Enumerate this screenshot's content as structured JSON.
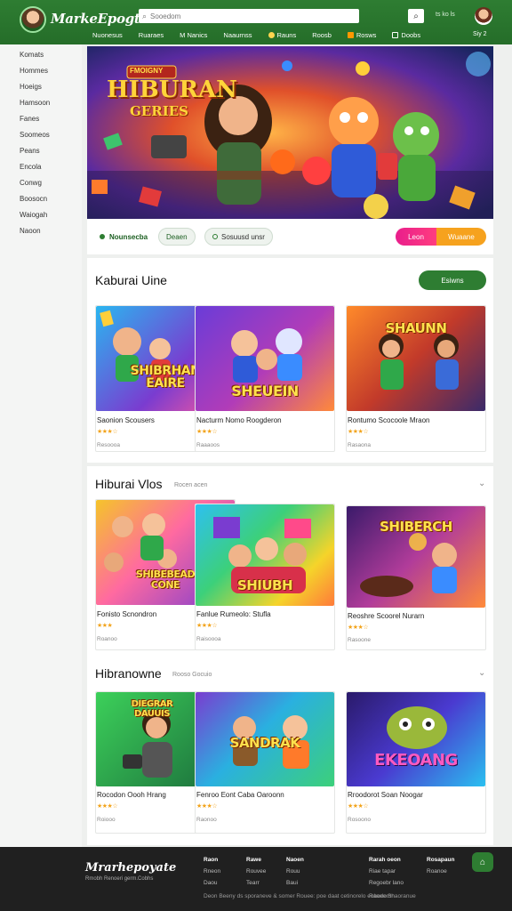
{
  "header": {
    "logo": "MarkeEpogte",
    "search_placeholder": "Sooedom",
    "top_links": "ts ko ls",
    "nav": [
      {
        "label": "Nuonesus",
        "color": "#ffffff"
      },
      {
        "label": "Ruaraes",
        "color": "#ffffff"
      },
      {
        "label": "M Nanics",
        "color": "#ffffff"
      },
      {
        "label": "Naaurnss",
        "color": "#ffffff"
      },
      {
        "label": "Rauns",
        "color": "#ffd54f"
      },
      {
        "label": "Roosb",
        "color": "#ffffff"
      },
      {
        "label": "Rosws",
        "color": "#ff9800"
      },
      {
        "label": "Doobs",
        "color": "#ffffff"
      }
    ],
    "nav_right": "Siy 2"
  },
  "sidebar": {
    "items": [
      "Komats",
      "Hommes",
      "Hoeigs",
      "Hamsoon",
      "Fanes",
      "Soomeos",
      "Peans",
      "Encola",
      "Conwg",
      "Boosocn",
      "Waiogah",
      "Naoon"
    ]
  },
  "hero": {
    "title_top": "HIBURAN",
    "title_bottom": "GERIES",
    "title_badge": "FMOIGNY"
  },
  "filters": {
    "chip1": "Nounsecba",
    "chip2": "Deaen",
    "chip3": "Sosuusd unsr",
    "pill_pink": "Leon",
    "pill_orange": "Wuaane"
  },
  "sections": [
    {
      "title": "Kaburai Uine",
      "subtitle": "",
      "action": "Esiwns",
      "cards": [
        {
          "thumb_title": "SHIBRHAN\nEAIRE",
          "name": "Saonion Scousers",
          "stars": "★★★☆",
          "meta": "Resoooa"
        },
        {
          "thumb_title": "SHEUEIN",
          "name": "Nacturm Nomo Roogderon",
          "stars": "★★★☆",
          "meta": "Raaaoos"
        },
        {
          "thumb_title": "SHAUNN",
          "name": "Rontumo Scocoole Mraon",
          "stars": "★★★☆",
          "meta": "Rasaona"
        }
      ]
    },
    {
      "title": "Hiburai Vlos",
      "subtitle": "Rocen acen",
      "action": "",
      "cards": [
        {
          "thumb_title": "SHIBEBEAD\nCONE",
          "name": "Fonisto Scnondron",
          "stars": "★★★",
          "meta": "Roanoo"
        },
        {
          "thumb_title": "SHIUBH",
          "name": "Fanlue Rumeolo: Stufla",
          "stars": "★★★☆",
          "meta": "Raisoooa"
        },
        {
          "thumb_title": "SHIBERCH",
          "name": "Reoshre Scoorel Nurarn",
          "stars": "★★★☆",
          "meta": "Rasoone"
        }
      ]
    },
    {
      "title": "Hibranowne",
      "subtitle": "Rooso Gocuio",
      "action": "",
      "cards": [
        {
          "thumb_title": "DIEGRAR\nDAUUIS",
          "name": "Rocodon Oooh Hrang",
          "stars": "★★★☆",
          "meta": "Roiooo"
        },
        {
          "thumb_title": "SANDRAK",
          "name": "Fenroo Eont Caba Oaroonn",
          "stars": "★★★☆",
          "meta": "Raonoo"
        },
        {
          "thumb_title": "EKEOANG",
          "name": "Rroodorot Soan Noogar",
          "stars": "★★★☆",
          "meta": "Rosoono"
        }
      ]
    }
  ],
  "footer": {
    "logo": "Mrarhepoyate",
    "tagline": "Rmobh Renoeri germ.Cobhs",
    "cols": [
      {
        "head": "Raon",
        "items": [
          "Rneon",
          "Daou"
        ]
      },
      {
        "head": "Rawe",
        "items": [
          "Rouvee",
          "Tearr"
        ]
      },
      {
        "head": "Naoen",
        "items": [
          "Rouu",
          "Baui"
        ]
      },
      {
        "head": "Rarah oeon",
        "items": [
          "Riae tapar",
          "Regoebr lano"
        ]
      },
      {
        "head": "Rosapaun",
        "items": [
          "Roanoe"
        ]
      }
    ],
    "bottom": "Deon Beeny ds sporaneve & somer Rouee: poe daat cetinorelo eobodomn",
    "bottom_right": "Raaee Shaoranue"
  },
  "colors": {
    "brand_green": "#2e7d32",
    "accent_orange": "#f6a21e",
    "accent_pink": "#e91e8c",
    "star": "#f2a31a"
  }
}
